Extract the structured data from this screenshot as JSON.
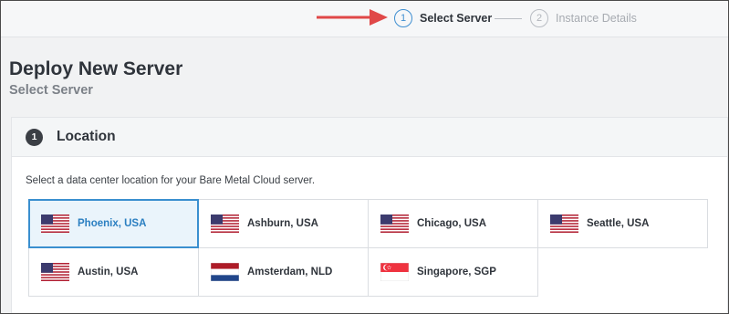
{
  "stepper": {
    "steps": [
      {
        "number": "1",
        "label": "Select Server",
        "active": true
      },
      {
        "number": "2",
        "label": "Instance Details",
        "active": false
      }
    ],
    "arrow_color": "#e04848"
  },
  "page": {
    "title": "Deploy New Server",
    "subtitle": "Select Server"
  },
  "location_section": {
    "number": "1",
    "title": "Location",
    "description": "Select a data center location for your Bare Metal Cloud server.",
    "locations": [
      {
        "label": "Phoenix, USA",
        "flag": "us-flag-icon",
        "selected": true
      },
      {
        "label": "Ashburn, USA",
        "flag": "us-flag-icon",
        "selected": false
      },
      {
        "label": "Chicago, USA",
        "flag": "us-flag-icon",
        "selected": false
      },
      {
        "label": "Seattle, USA",
        "flag": "us-flag-icon",
        "selected": false
      },
      {
        "label": "Austin, USA",
        "flag": "us-flag-icon",
        "selected": false
      },
      {
        "label": "Amsterdam, NLD",
        "flag": "netherlands-flag-icon",
        "selected": false
      },
      {
        "label": "Singapore, SGP",
        "flag": "singapore-flag-icon",
        "selected": false
      }
    ]
  },
  "colors": {
    "accent": "#3a8fcf",
    "selected_bg": "#eaf4fb",
    "text": "#2f343b"
  }
}
